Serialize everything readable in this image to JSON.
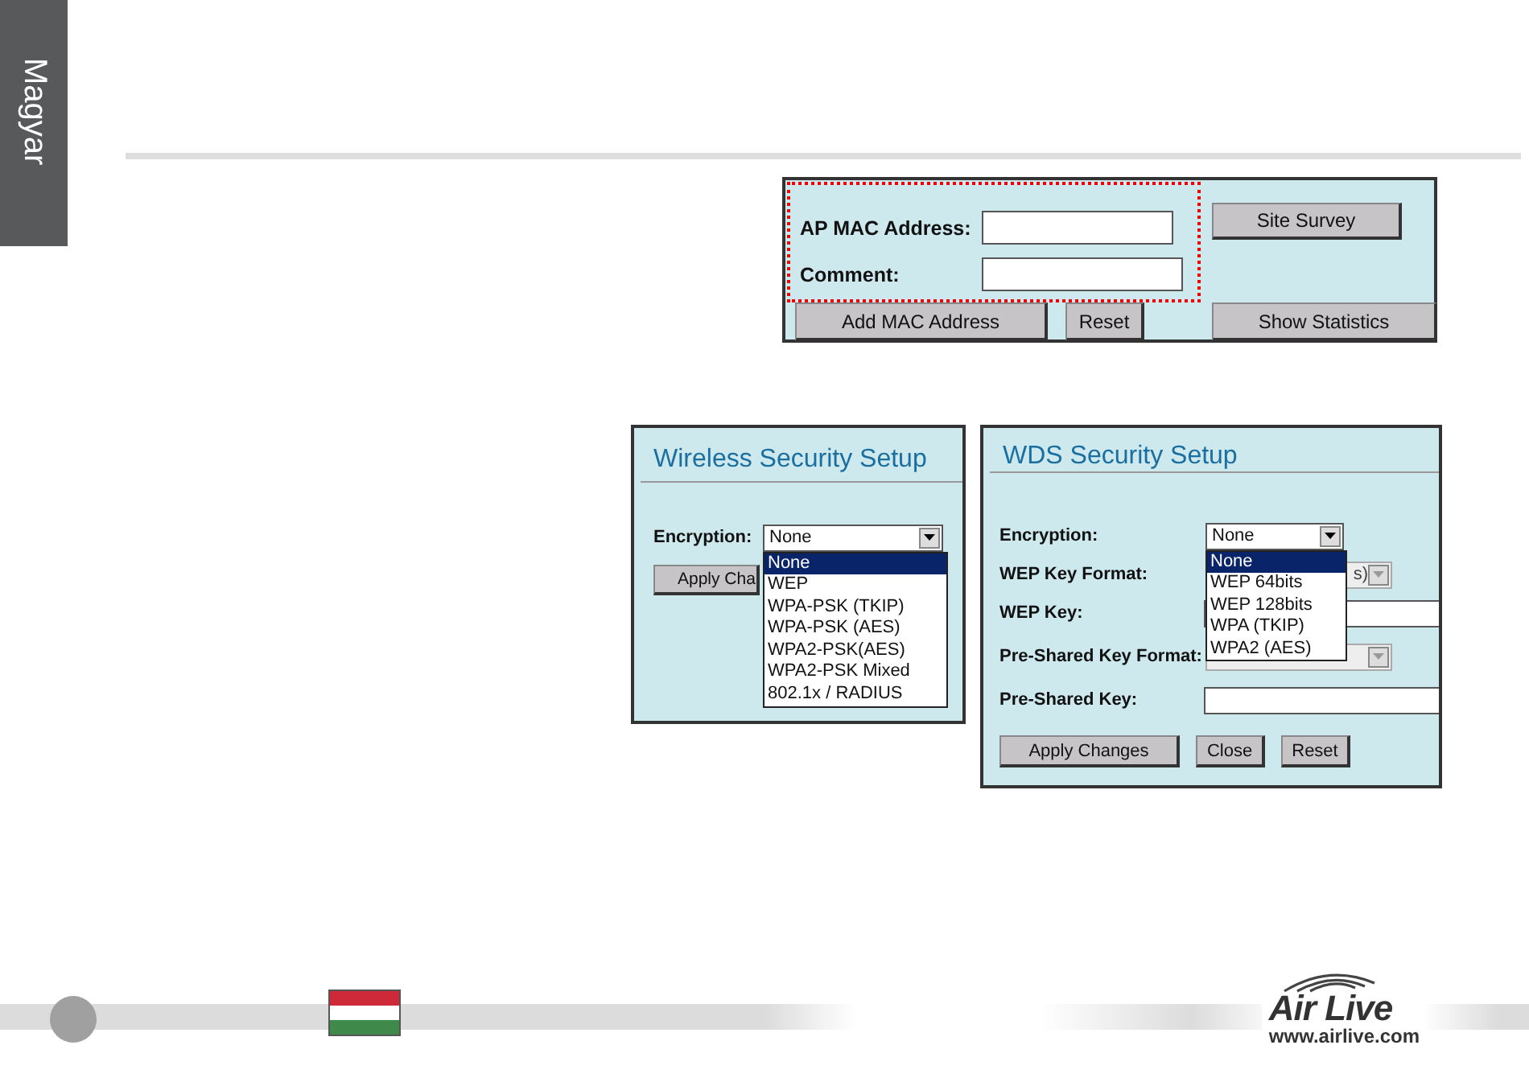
{
  "side_tab": {
    "label": "Magyar"
  },
  "mac_panel": {
    "fields": [
      {
        "label": "AP MAC Address:"
      },
      {
        "label": "Comment:"
      }
    ],
    "buttons": [
      "Add MAC Address",
      "Reset"
    ],
    "side_buttons": [
      "Site Survey",
      "Show Statistics"
    ]
  },
  "wireless_panel": {
    "title": "Wireless Security Setup",
    "label": "Encryption:",
    "value": "None",
    "button": "Apply Cha",
    "options": [
      {
        "label": "None",
        "selected": true
      },
      {
        "label": "WEP",
        "selected": false
      },
      {
        "label": "WPA-PSK (TKIP)",
        "selected": false
      },
      {
        "label": "WPA-PSK (AES)",
        "selected": false
      },
      {
        "label": "WPA2-PSK(AES)",
        "selected": false
      },
      {
        "label": "WPA2-PSK Mixed",
        "selected": false
      },
      {
        "label": "802.1x / RADIUS",
        "selected": false
      }
    ]
  },
  "wds_panel": {
    "title": "WDS Security Setup",
    "rows": [
      {
        "kind": "select",
        "label": "Encryption:",
        "value": "None",
        "disabled": false
      },
      {
        "kind": "select",
        "label": "WEP Key Format:",
        "value": "s)",
        "disabled": true
      },
      {
        "kind": "input",
        "label": "WEP Key:"
      },
      {
        "kind": "select",
        "label": "Pre-Shared Key Format:",
        "disabled": true
      },
      {
        "kind": "input",
        "label": "Pre-Shared Key:"
      }
    ],
    "options": [
      {
        "label": "None",
        "selected": true
      },
      {
        "label": "WEP 64bits",
        "selected": false
      },
      {
        "label": "WEP 128bits",
        "selected": false
      },
      {
        "label": "WPA (TKIP)",
        "selected": false
      },
      {
        "label": "WPA2 (AES)",
        "selected": false
      }
    ],
    "buttons": [
      "Apply Changes",
      "Close",
      "Reset"
    ]
  },
  "footer": {
    "logo": "Air Live",
    "url": "www.airlive.com"
  }
}
